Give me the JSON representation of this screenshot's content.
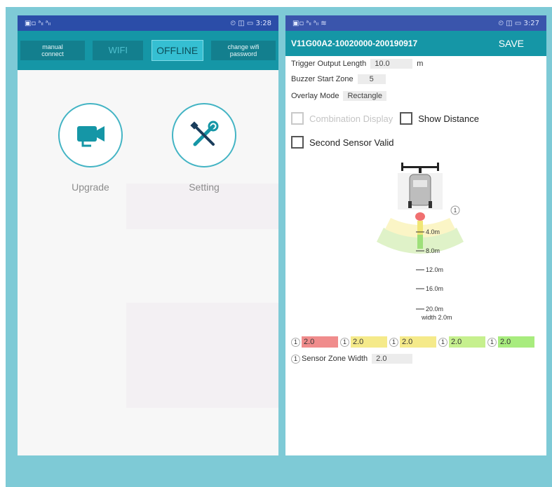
{
  "left_phone": {
    "status_left": "▣▫ ᵃₗₗ ᵃₗₗ",
    "status_right": "⏲ ◫ ▭ 3:28",
    "buttons": {
      "manual_connect": "manual\nconnect",
      "wifi": "WIFI",
      "offline": "OFFLINE",
      "change_wifi": "change wifi\npassword"
    },
    "tiles": [
      {
        "label": "Upgrade",
        "icon": "camera-icon"
      },
      {
        "label": "Setting",
        "icon": "tools-icon"
      }
    ]
  },
  "right_phone": {
    "status_left": "▣▫ ᵃₗₗ ᵃₗₗ ≋",
    "status_right": "⏲ ◫ ▭ 3:27",
    "title": "V11G00A2-10020000-200190917",
    "save_label": "SAVE",
    "trigger_output_length": {
      "label": "Trigger Output Length",
      "value": "10.0",
      "unit": "m"
    },
    "buzzer_start_zone": {
      "label": "Buzzer Start Zone",
      "value": "5"
    },
    "overlay_mode": {
      "label": "Overlay Mode",
      "value": "Rectangle"
    },
    "combination_display": {
      "label": "Combination Display",
      "checked": false,
      "enabled": false
    },
    "show_distance": {
      "label": "Show Distance",
      "checked": false
    },
    "second_sensor_valid": {
      "label": "Second Sensor Valid",
      "checked": false
    },
    "sensor_badge": "1",
    "distance_ticks": [
      "4.0m",
      "8.0m",
      "12.0m",
      "16.0m",
      "20.0m"
    ],
    "width_label": "width 2.0m",
    "zones": [
      {
        "num": "1",
        "value": "2.0",
        "color": "#f08c8c"
      },
      {
        "num": "1",
        "value": "2.0",
        "color": "#f5ea8a"
      },
      {
        "num": "1",
        "value": "2.0",
        "color": "#f5ea8a"
      },
      {
        "num": "1",
        "value": "2.0",
        "color": "#c6f08e"
      },
      {
        "num": "1",
        "value": "2.0",
        "color": "#a8ec7e"
      }
    ],
    "sensor_zone_width": {
      "num": "1",
      "label": "Sensor Zone Width",
      "value": "2.0"
    }
  },
  "colors": {
    "frame": "#7ecad6",
    "statusbar": "#2b4da8",
    "appbar": "#1596a6",
    "accent": "#43b4c4"
  }
}
